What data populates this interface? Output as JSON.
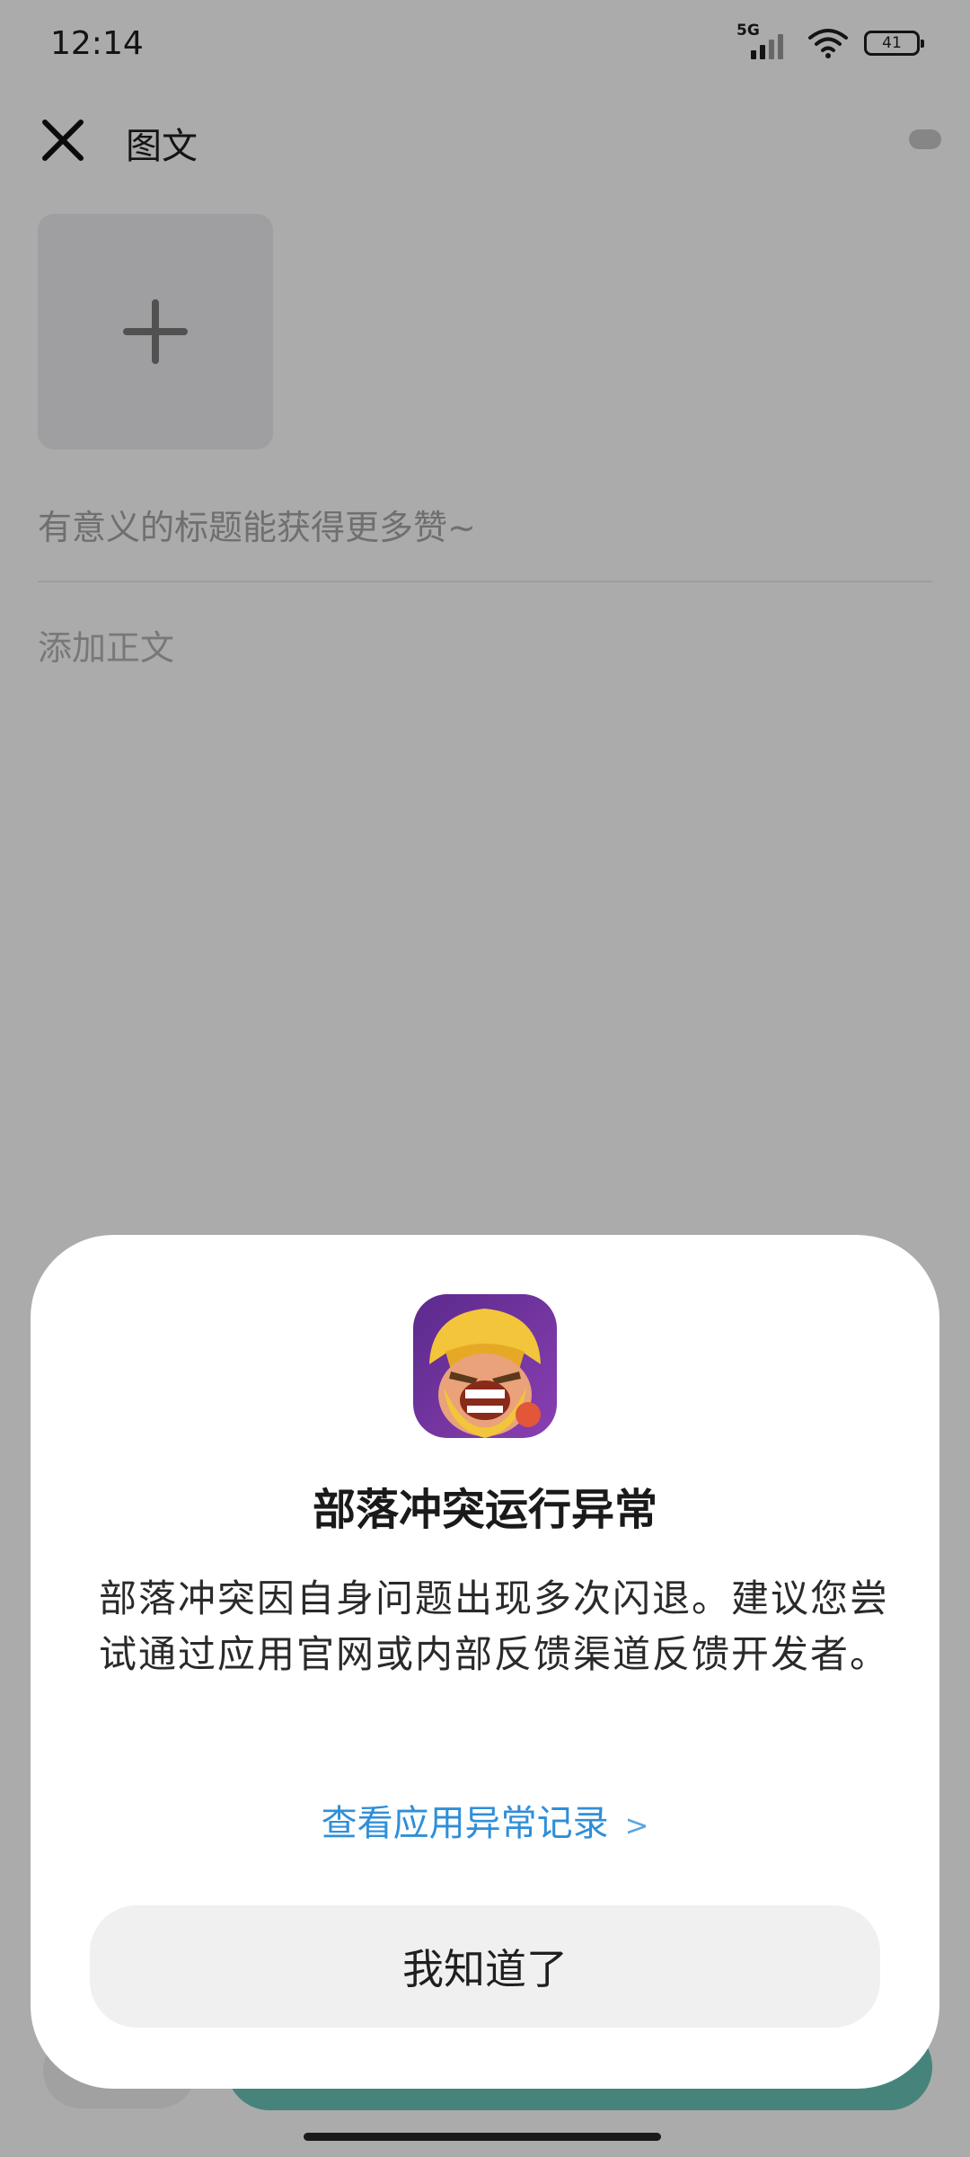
{
  "status_bar": {
    "time": "12:14",
    "network": "5G",
    "battery": "41"
  },
  "header": {
    "title": "图文",
    "close_icon": "close-icon"
  },
  "editor": {
    "add_image_icon": "plus-icon",
    "title_placeholder": "有意义的标题能获得更多赞~",
    "body_placeholder": "添加正文"
  },
  "dialog": {
    "app_icon": "app-icon",
    "title": "部落冲突运行异常",
    "message": "部落冲突因自身问题出现多次闪退。建议您尝试通过应用官网或内部反馈渠道反馈开发者。",
    "link_label": "查看应用异常记录",
    "link_chevron": ">",
    "button_label": "我知道了"
  },
  "colors": {
    "link": "#2f8fd8",
    "publish_button": "#69c5b8",
    "scrim": "rgba(0,0,0,0.33)"
  }
}
